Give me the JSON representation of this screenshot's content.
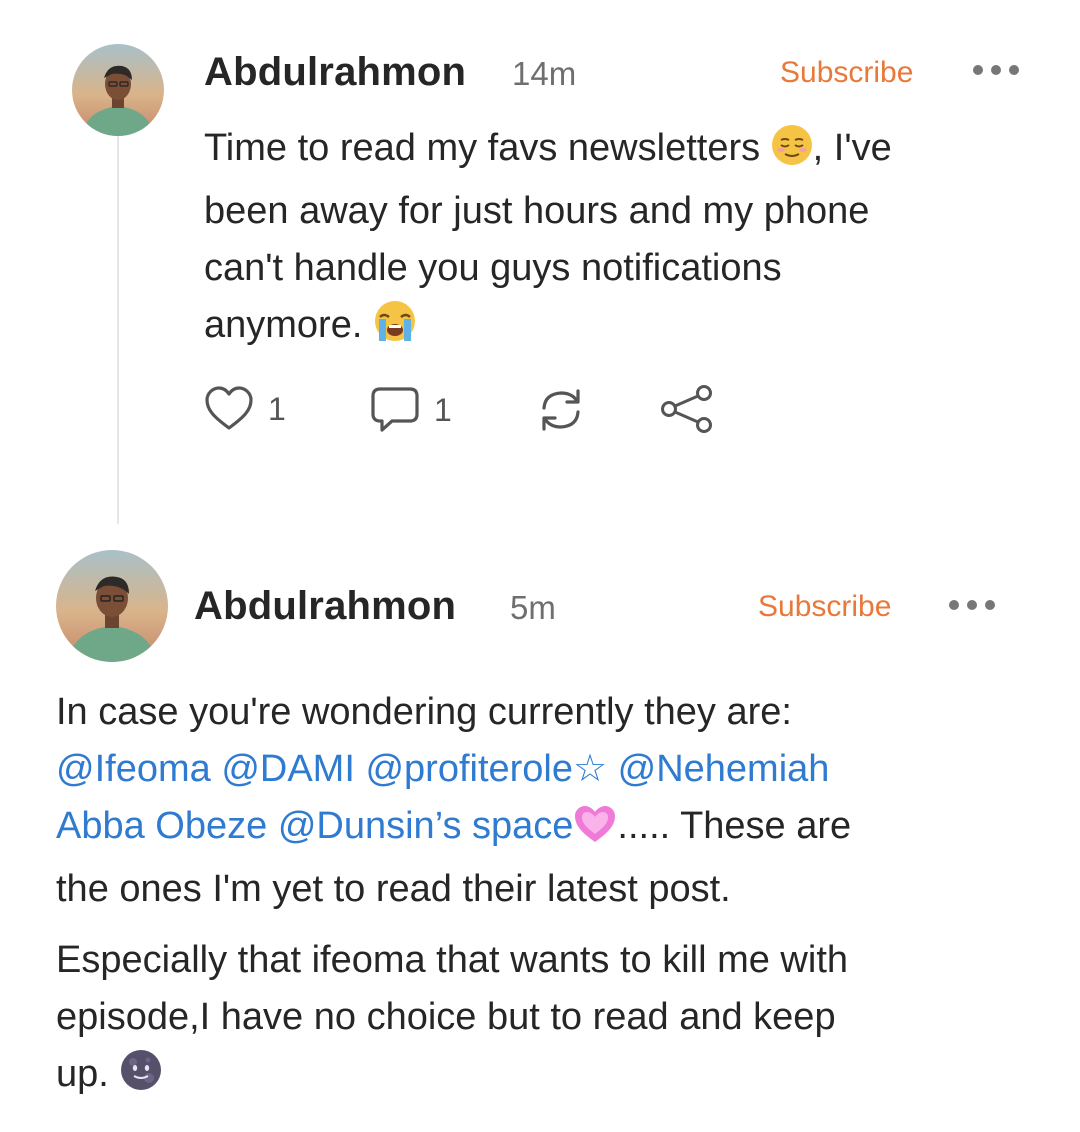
{
  "posts": [
    {
      "author": "Abdulrahmon",
      "time": "14m",
      "subscribe_label": "Subscribe",
      "body": {
        "line1_a": "Time to read my favs newsletters",
        "line1_b": ", I've",
        "line2": "been away for just hours and my phone",
        "line3": "can't handle you guys notifications",
        "line4": "anymore."
      },
      "actions": {
        "likes": "1",
        "comments": "1"
      }
    },
    {
      "author": "Abdulrahmon",
      "time": "5m",
      "subscribe_label": "Subscribe",
      "body": {
        "p1_line1": "In case you're wondering currently they are:",
        "mention_ifeoma": "@Ifeoma",
        "mention_dami": "@DAMI",
        "mention_profiterole": "@profiterole☆",
        "mention_nehemiah_1": "@Nehemiah",
        "mention_nehemiah_2": "Abba Obeze",
        "mention_dunsin": "@Dunsin’s space",
        "p1_after_mentions": "..... These are",
        "p1_line4": "the ones I'm yet to read their latest post.",
        "p2_line1": "Especially that ifeoma that wants to kill me with",
        "p2_line2": "episode,I have no choice but to read and keep",
        "p2_line3": "up."
      }
    }
  ],
  "colors": {
    "accent": "#e8793b",
    "mention": "#2f7bd1",
    "text": "#262626",
    "muted": "#6f6f6f"
  },
  "icons": [
    "heart-icon",
    "comment-icon",
    "restack-icon",
    "share-icon",
    "more-icon"
  ]
}
